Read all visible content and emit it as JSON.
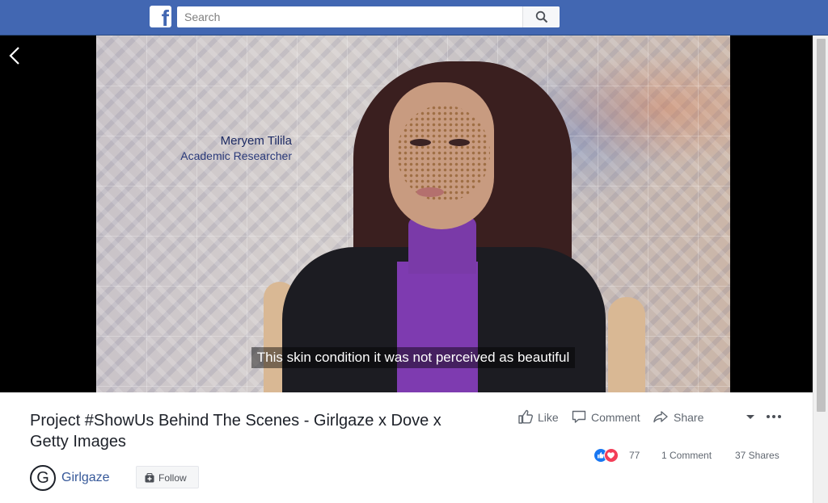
{
  "topbar": {
    "logo_letter": "f",
    "search_placeholder": "Search",
    "colors": {
      "bar": "#4267b2"
    }
  },
  "video": {
    "lower_third": {
      "name": "Meryem Tilila",
      "role": "Academic Researcher"
    },
    "caption": "This skin condition it was not perceived as beautiful"
  },
  "post": {
    "title": "Project #ShowUs Behind The Scenes - Girlgaze x Dove x Getty Images",
    "page": {
      "avatar_letter": "G",
      "name": "Girlgaze",
      "follow_label": "Follow"
    },
    "actions": {
      "like": "Like",
      "comment": "Comment",
      "share": "Share"
    },
    "stats": {
      "reactions_count": "77",
      "comments": "1 Comment",
      "shares": "37 Shares"
    }
  },
  "icons": [
    "facebook-logo-icon",
    "search-icon",
    "back-arrow-icon",
    "like-icon",
    "comment-icon",
    "share-icon",
    "caret-down-icon",
    "more-dots-icon",
    "follow-icon",
    "like-reaction-icon",
    "love-reaction-icon"
  ]
}
